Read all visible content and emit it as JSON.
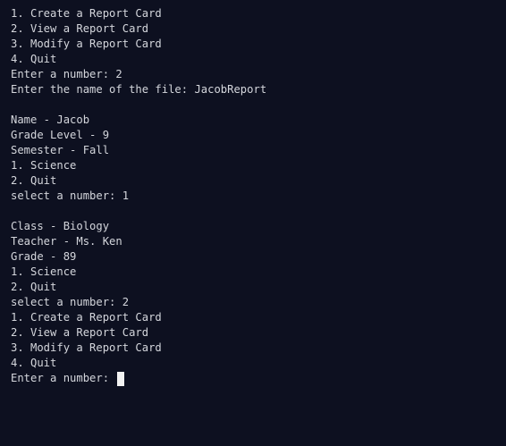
{
  "terminal": {
    "lines": [
      "1. Create a Report Card",
      "2. View a Report Card",
      "3. Modify a Report Card",
      "4. Quit",
      "Enter a number: 2",
      "Enter the name of the file: JacobReport",
      "",
      "Name - Jacob",
      "Grade Level - 9",
      "Semester - Fall",
      "1. Science",
      "2. Quit",
      "select a number: 1",
      "",
      "Class - Biology",
      "Teacher - Ms. Ken",
      "Grade - 89",
      "1. Science",
      "2. Quit",
      "select a number: 2",
      "1. Create a Report Card",
      "2. View a Report Card",
      "3. Modify a Report Card",
      "4. Quit"
    ],
    "prompt": "Enter a number: ",
    "colors": {
      "background": "#0d1020",
      "text": "#d4d6dc",
      "cursor": "#f2f2f2"
    }
  }
}
